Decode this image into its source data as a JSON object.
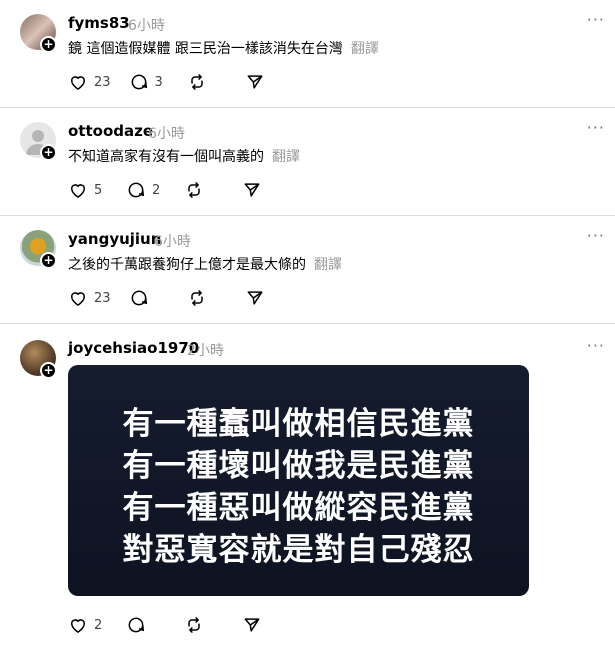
{
  "posts": [
    {
      "username": "fyms83",
      "time": "6小時",
      "content": "鏡 這個造假媒體 跟三民治一樣該消失在台灣",
      "translate": "翻譯",
      "likes": "23",
      "replies": "3",
      "reposts": "",
      "shares": ""
    },
    {
      "username": "ottoodaze",
      "time": "6小時",
      "content": "不知道高家有沒有一個叫高義的",
      "translate": "翻譯",
      "likes": "5",
      "replies": "2",
      "reposts": "",
      "shares": ""
    },
    {
      "username": "yangyujiun",
      "time": "6小時",
      "content": "之後的千萬跟養狗仔上億才是最大條的",
      "translate": "翻譯",
      "likes": "23",
      "replies": "",
      "reposts": "",
      "shares": ""
    },
    {
      "username": "joycehsiao1970",
      "time": "2小時",
      "image_text": [
        "有一種蠢叫做相信民進黨",
        "有一種壞叫做我是民進黨",
        "有一種惡叫做縱容民進黨",
        "對惡寬容就是對自己殘忍"
      ],
      "likes": "2",
      "replies": "",
      "reposts": "",
      "shares": ""
    }
  ],
  "icons": {
    "like": "heart-icon",
    "reply": "comment-icon",
    "repost": "repost-icon",
    "share": "send-icon",
    "more": "more-options-icon",
    "follow": "plus-icon"
  },
  "more_glyph": "···",
  "follow_glyph": "+"
}
